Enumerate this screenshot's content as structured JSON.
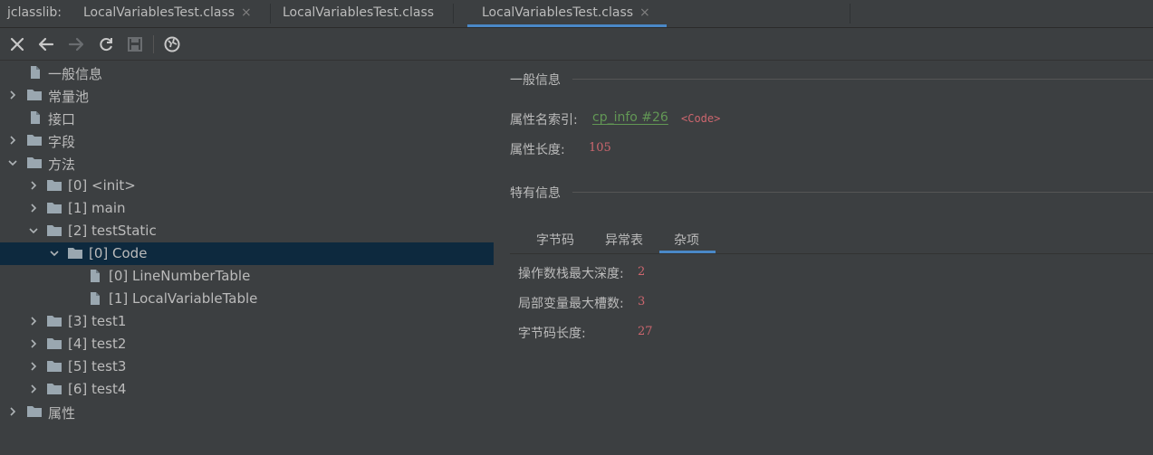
{
  "tabbar": {
    "prefix": "jclasslib:",
    "tabs": [
      {
        "label": "LocalVariablesTest.class",
        "active": false
      },
      {
        "label": "LocalVariablesTest.class",
        "active": false
      },
      {
        "label": "LocalVariablesTest.class",
        "active": true
      }
    ],
    "close_glyph": "×",
    "accent": "#4a88c7"
  },
  "toolbar": {
    "icons": [
      "close-icon",
      "back-arrow-icon",
      "forward-arrow-icon",
      "refresh-icon",
      "save-icon",
      "web-icon"
    ]
  },
  "tree": {
    "items": [
      {
        "label": "一般信息",
        "icon": "file-icon",
        "expandable": false
      },
      {
        "label": "常量池",
        "icon": "folder-icon",
        "expandable": true,
        "expanded": false
      },
      {
        "label": "接口",
        "icon": "file-icon",
        "expandable": false
      },
      {
        "label": "字段",
        "icon": "folder-icon",
        "expandable": true,
        "expanded": false
      },
      {
        "label": "方法",
        "icon": "folder-icon",
        "expandable": true,
        "expanded": true
      },
      {
        "label": "[0] <init>",
        "icon": "folder-icon",
        "expandable": true,
        "expanded": false
      },
      {
        "label": "[1] main",
        "icon": "folder-icon",
        "expandable": true,
        "expanded": false
      },
      {
        "label": "[2] testStatic",
        "icon": "folder-icon",
        "expandable": true,
        "expanded": true
      },
      {
        "label": "[0] Code",
        "icon": "folder-icon",
        "expandable": true,
        "expanded": true,
        "selected": true
      },
      {
        "label": "[0] LineNumberTable",
        "icon": "file-icon",
        "expandable": false
      },
      {
        "label": "[1] LocalVariableTable",
        "icon": "file-icon",
        "expandable": false
      },
      {
        "label": "[3] test1",
        "icon": "folder-icon",
        "expandable": true,
        "expanded": false
      },
      {
        "label": "[4] test2",
        "icon": "folder-icon",
        "expandable": true,
        "expanded": false
      },
      {
        "label": "[5] test3",
        "icon": "folder-icon",
        "expandable": true,
        "expanded": false
      },
      {
        "label": "[6] test4",
        "icon": "folder-icon",
        "expandable": true,
        "expanded": false
      },
      {
        "label": "属性",
        "icon": "folder-icon",
        "expandable": true,
        "expanded": false
      }
    ],
    "selected_color": "#0d293e"
  },
  "general": {
    "title": "一般信息",
    "name_index_label": "属性名索引:",
    "name_index_link": "cp_info #26",
    "name_index_value": "<Code>",
    "length_label": "属性长度:",
    "length_value": "105"
  },
  "specific": {
    "title": "特有信息",
    "tabs": [
      "字节码",
      "异常表",
      "杂项"
    ],
    "active_tab": "杂项",
    "max_stack_label": "操作数栈最大深度:",
    "max_stack_value": "2",
    "max_locals_label": "局部变量最大槽数:",
    "max_locals_value": "3",
    "code_length_label": "字节码长度:",
    "code_length_value": "27"
  },
  "colors": {
    "background": "#3c3f41",
    "text": "#bbbbbb",
    "link": "#629755",
    "value": "#cc666e"
  }
}
